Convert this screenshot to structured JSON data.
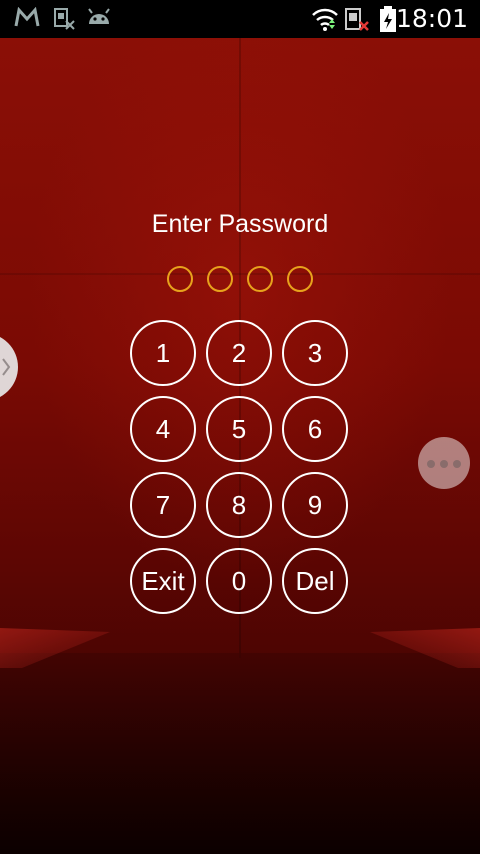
{
  "status_bar": {
    "time": "18:01",
    "icons": [
      "gmail-icon",
      "sim-blocked-icon",
      "android-debug-icon",
      "wifi-icon",
      "sim-no-signal-icon",
      "battery-charging-icon"
    ]
  },
  "lock_screen": {
    "title": "Enter Password",
    "pin_slots": 4,
    "keys": [
      "1",
      "2",
      "3",
      "4",
      "5",
      "6",
      "7",
      "8",
      "9",
      "Exit",
      "0",
      "Del"
    ]
  },
  "colors": {
    "accent_dot": "#e8a21c",
    "key_ring": "#ffffff",
    "background": "#7a0a04"
  }
}
